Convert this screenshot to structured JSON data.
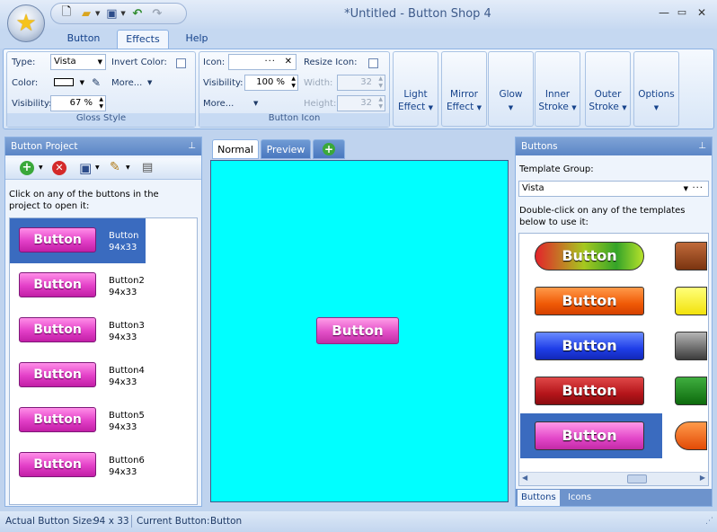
{
  "window": {
    "title": "*Untitled - Button Shop 4"
  },
  "ribbon_tabs": [
    "Button",
    "Effects",
    "Help"
  ],
  "gloss_style": {
    "group_label": "Gloss Style",
    "type_label": "Type:",
    "type_value": "Vista",
    "invert_color_label": "Invert Color:",
    "color_label": "Color:",
    "more_label": "More...",
    "visibility_label": "Visibility:",
    "visibility_value": "67 %"
  },
  "button_icon": {
    "group_label": "Button Icon",
    "icon_label": "Icon:",
    "resize_icon_label": "Resize Icon:",
    "visibility_label": "Visibility:",
    "visibility_value": "100 %",
    "width_label": "Width:",
    "width_value": "32",
    "height_label": "Height:",
    "height_value": "32",
    "more_label": "More..."
  },
  "effect_buttons": [
    {
      "line1": "Light",
      "line2": "Effect"
    },
    {
      "line1": "Mirror",
      "line2": "Effect"
    },
    {
      "line1": "Glow",
      "line2": ""
    },
    {
      "line1": "Inner",
      "line2": "Stroke"
    },
    {
      "line1": "Outer",
      "line2": "Stroke"
    },
    {
      "line1": "Options",
      "line2": ""
    }
  ],
  "left_panel": {
    "title": "Button Project",
    "instructions": "Click on any of the buttons in the project to open it:",
    "items": [
      {
        "button_text": "Button",
        "name": "Button",
        "size": "94x33"
      },
      {
        "button_text": "Button",
        "name": "Button2",
        "size": "94x33"
      },
      {
        "button_text": "Button",
        "name": "Button3",
        "size": "94x33"
      },
      {
        "button_text": "Button",
        "name": "Button4",
        "size": "94x33"
      },
      {
        "button_text": "Button",
        "name": "Button5",
        "size": "94x33"
      },
      {
        "button_text": "Button",
        "name": "Button6",
        "size": "94x33"
      }
    ]
  },
  "center": {
    "tabs": [
      "Normal",
      "Preview"
    ],
    "canvas_color": "#00ffff",
    "preview_button_text": "Button"
  },
  "right_panel": {
    "title": "Buttons",
    "template_group_label": "Template Group:",
    "template_group_value": "Vista",
    "instructions": "Double-click on any of the templates below to use it:",
    "templates": [
      {
        "text": "Button",
        "style": "green-gradient"
      },
      {
        "text": "Button",
        "style": "orange"
      },
      {
        "text": "Button",
        "style": "blue"
      },
      {
        "text": "Button",
        "style": "red"
      },
      {
        "text": "Button",
        "style": "pink"
      }
    ],
    "bottom_tabs": [
      "Buttons",
      "Icons"
    ]
  },
  "status_bar": {
    "actual_size_label": "Actual Button Size:",
    "actual_size_value": "94 x 33",
    "current_button_label": "Current Button:",
    "current_button_value": "Button"
  }
}
